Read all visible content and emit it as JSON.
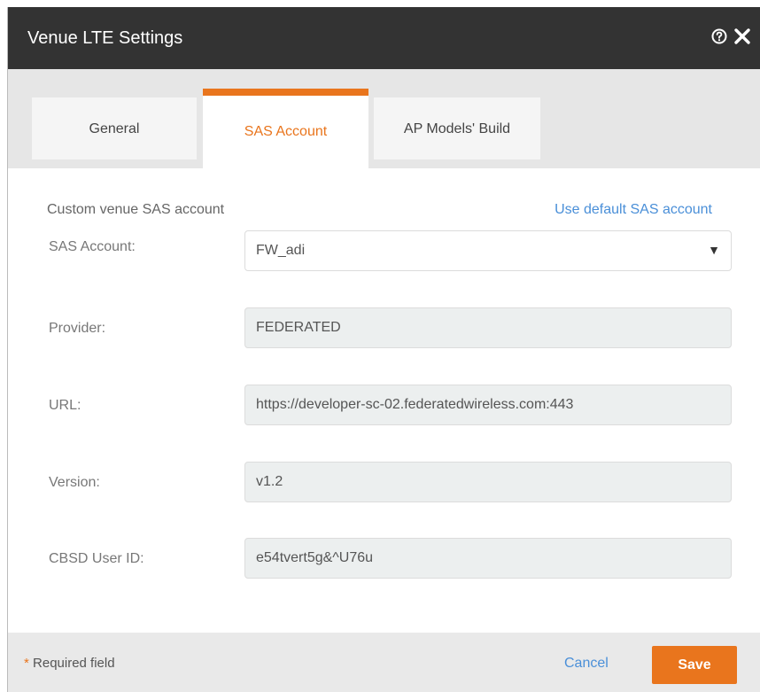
{
  "window": {
    "title": "Venue LTE Settings",
    "help_icon": "help-circle-icon",
    "close_icon": "close-icon"
  },
  "tabs": [
    {
      "label": "General",
      "active": false
    },
    {
      "label": "SAS Account",
      "active": true
    },
    {
      "label": "AP Models' Build",
      "active": false
    }
  ],
  "form": {
    "section_label": "Custom venue SAS account",
    "default_link": "Use default SAS account",
    "sas_account": {
      "label": "SAS Account:",
      "value": "FW_adi"
    },
    "provider": {
      "label": "Provider:",
      "value": "FEDERATED"
    },
    "url": {
      "label": "URL:",
      "value": "https://developer-sc-02.federatedwireless.com:443"
    },
    "version": {
      "label": "Version:",
      "value": "v1.2"
    },
    "cbsd_user_id": {
      "label": "CBSD User ID:",
      "value": "e54tvert5g&^U76u"
    }
  },
  "footer": {
    "required_star": "*",
    "required_text": "Required field",
    "cancel_label": "Cancel",
    "save_label": "Save"
  },
  "colors": {
    "accent": "#e9751d",
    "link": "#4a8fd8",
    "titlebar": "#333333"
  }
}
